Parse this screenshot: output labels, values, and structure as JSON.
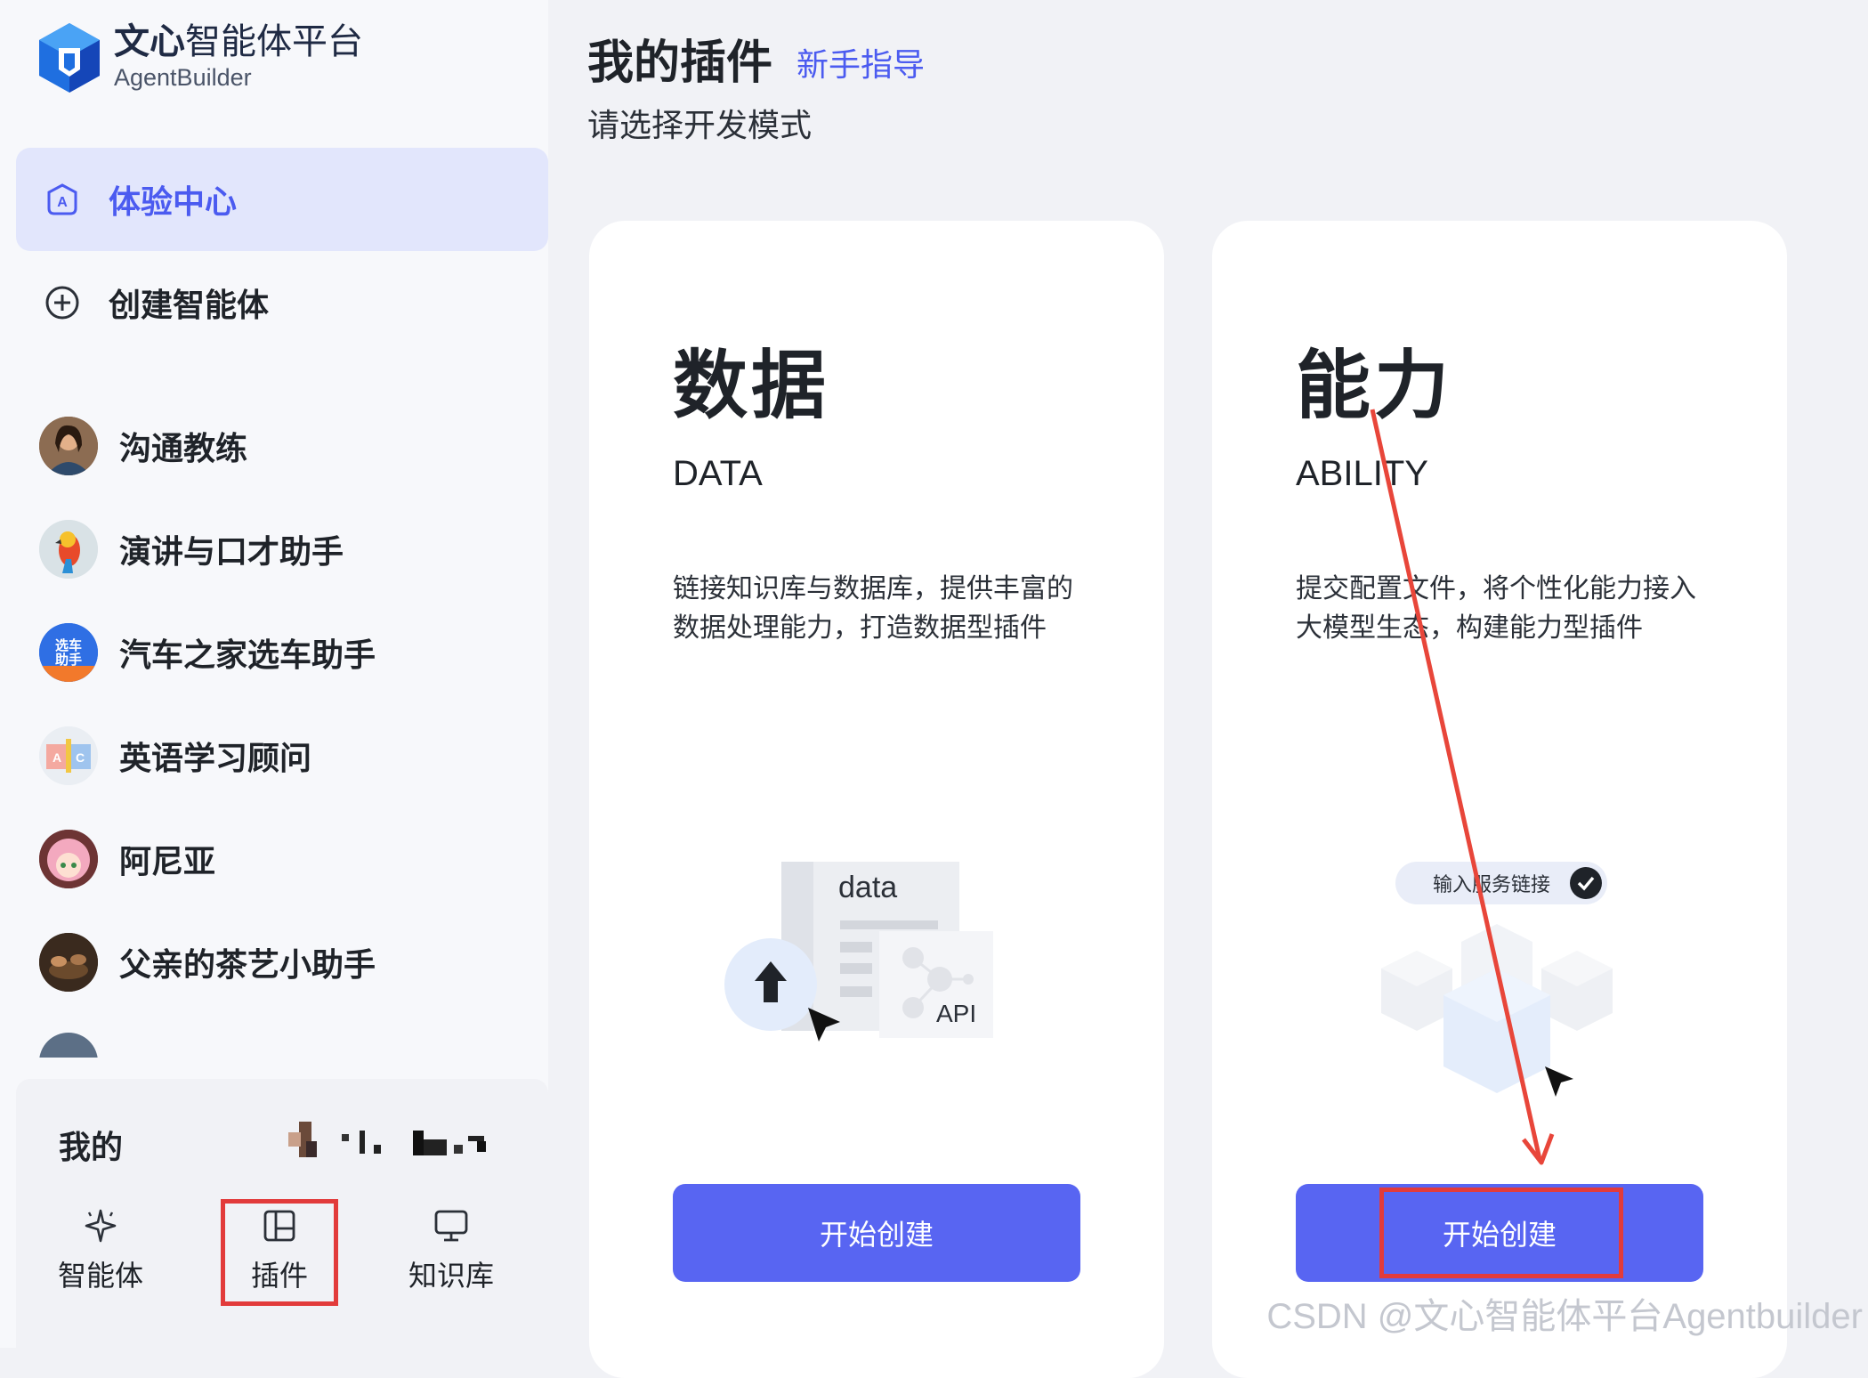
{
  "brand": {
    "title_bold": "文心",
    "title_rest": "智能体平台",
    "subtitle": "AgentBuilder"
  },
  "nav": [
    {
      "label": "体验中心",
      "icon": "experience-center-icon",
      "active": true
    },
    {
      "label": "创建智能体",
      "icon": "plus-circle-icon",
      "active": false
    }
  ],
  "agents": [
    {
      "label": "沟通教练",
      "avatar": "avatar-woman"
    },
    {
      "label": "演讲与口才助手",
      "avatar": "avatar-parrot"
    },
    {
      "label": "汽车之家选车助手",
      "avatar": "avatar-car",
      "avatar_text": "选车助手"
    },
    {
      "label": "英语学习顾问",
      "avatar": "avatar-abc"
    },
    {
      "label": "阿尼亚",
      "avatar": "avatar-anya"
    },
    {
      "label": "父亲的茶艺小助手",
      "avatar": "avatar-tea"
    }
  ],
  "bottom": {
    "mine_label": "我的",
    "tabs": [
      {
        "label": "智能体",
        "icon": "sparkle-icon"
      },
      {
        "label": "插件",
        "icon": "plugin-icon",
        "highlighted": true
      },
      {
        "label": "知识库",
        "icon": "monitor-icon"
      }
    ]
  },
  "main": {
    "title": "我的插件",
    "guide_link": "新手指导",
    "subtitle": "请选择开发模式",
    "cards": [
      {
        "title": "数据",
        "title_en": "DATA",
        "desc": "链接知识库与数据库，提供丰富的数据处理能力，打造数据型插件",
        "illus_label_1": "data",
        "illus_label_2": "API",
        "button": "开始创建"
      },
      {
        "title": "能力",
        "title_en": "ABILITY",
        "desc": "提交配置文件，将个性化能力接入大模型生态，构建能力型插件",
        "pill_text": "输入服务链接",
        "button": "开始创建"
      }
    ]
  },
  "watermark": "CSDN @文心智能体平台Agentbuilder",
  "colors": {
    "accent": "#5865f2",
    "annotation_red": "#e23b3b",
    "active_nav_bg": "#e2e6fc"
  }
}
